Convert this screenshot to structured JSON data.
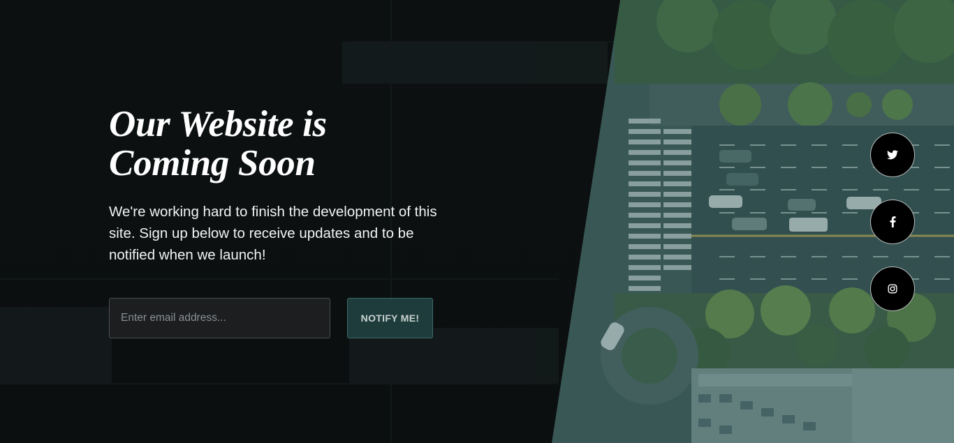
{
  "hero": {
    "title_line1": "Our Website is",
    "title_line2": "Coming Soon",
    "subtitle": "We're working hard to finish the development of this site. Sign up below to receive updates and to be notified when we launch!"
  },
  "signup": {
    "email_placeholder": "Enter email address...",
    "email_value": "",
    "button_label": "NOTIFY ME!"
  },
  "social": [
    {
      "name": "twitter",
      "icon": "twitter-icon"
    },
    {
      "name": "facebook",
      "icon": "facebook-icon"
    },
    {
      "name": "instagram",
      "icon": "instagram-icon"
    }
  ],
  "colors": {
    "overlay": "#0c1011",
    "photo_tint": "#3c5654",
    "button_bg": "#1d3c3b",
    "input_bg": "#1c1e20",
    "social_bg": "#000000",
    "text": "#ffffff"
  }
}
